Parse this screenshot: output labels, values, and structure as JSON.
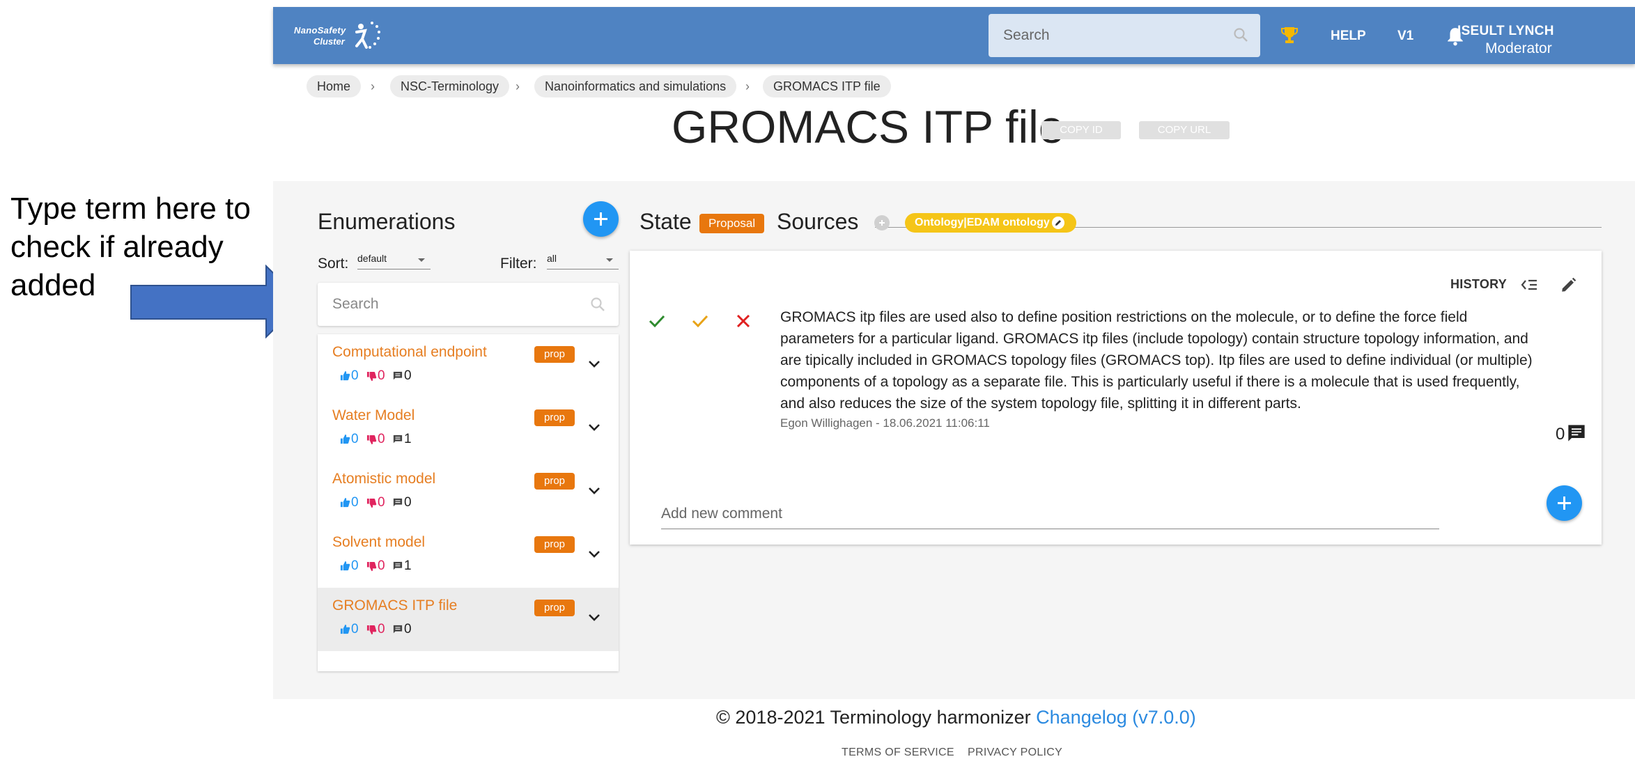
{
  "annotation": {
    "text": "Type term here to check if already added"
  },
  "header": {
    "logo_line1": "NanoSafety",
    "logo_line2": "Cluster",
    "search_placeholder": "Search",
    "help": "HELP",
    "version": "V1",
    "user_name": "ISEULT LYNCH",
    "user_role": "Moderator",
    "brand_color": "#4f83c2"
  },
  "breadcrumb": [
    "Home",
    "NSC-Terminology",
    "Nanoinformatics and simulations",
    "GROMACS ITP file"
  ],
  "page": {
    "title": "GROMACS ITP file",
    "copy_id": "COPY ID",
    "copy_url": "COPY URL"
  },
  "enumerations": {
    "title": "Enumerations",
    "sort_label": "Sort:",
    "sort_value": "default",
    "filter_label": "Filter:",
    "filter_value": "all",
    "search_placeholder": "Search",
    "items": [
      {
        "name": "Computational endpoint",
        "badge": "prop",
        "up": "0",
        "down": "0",
        "comments": "0"
      },
      {
        "name": "Water Model",
        "badge": "prop",
        "up": "0",
        "down": "0",
        "comments": "1"
      },
      {
        "name": "Atomistic model",
        "badge": "prop",
        "up": "0",
        "down": "0",
        "comments": "0"
      },
      {
        "name": "Solvent model",
        "badge": "prop",
        "up": "0",
        "down": "0",
        "comments": "1"
      },
      {
        "name": "GROMACS ITP file",
        "badge": "prop",
        "up": "0",
        "down": "0",
        "comments": "0"
      }
    ]
  },
  "detail": {
    "state_label": "State",
    "state_value": "Proposal",
    "sources_label": "Sources",
    "source_chip": "Ontology|EDAM ontology",
    "history": "HISTORY",
    "description": "GROMACS itp files are used also to define position restrictions on the molecule, or to define the force field parameters for a particular ligand. GROMACS itp files (include topology) contain structure topology information, and are tipically included in GROMACS topology files (GROMACS top). Itp files are used to define individual (or multiple) components of a topology as a separate file. This is particularly useful if there is a molecule that is used frequently, and also reduces the size of the system topology file, splitting it in different parts.",
    "author_meta": "Egon Willighagen - 18.06.2021 11:06:11",
    "comment_count": "0",
    "comment_placeholder": "Add new comment"
  },
  "footer": {
    "copyright": "© 2018-2021 Terminology harmonizer ",
    "changelog": "Changelog (v7.0.0)",
    "terms": "TERMS OF SERVICE",
    "privacy": "PRIVACY POLICY"
  }
}
